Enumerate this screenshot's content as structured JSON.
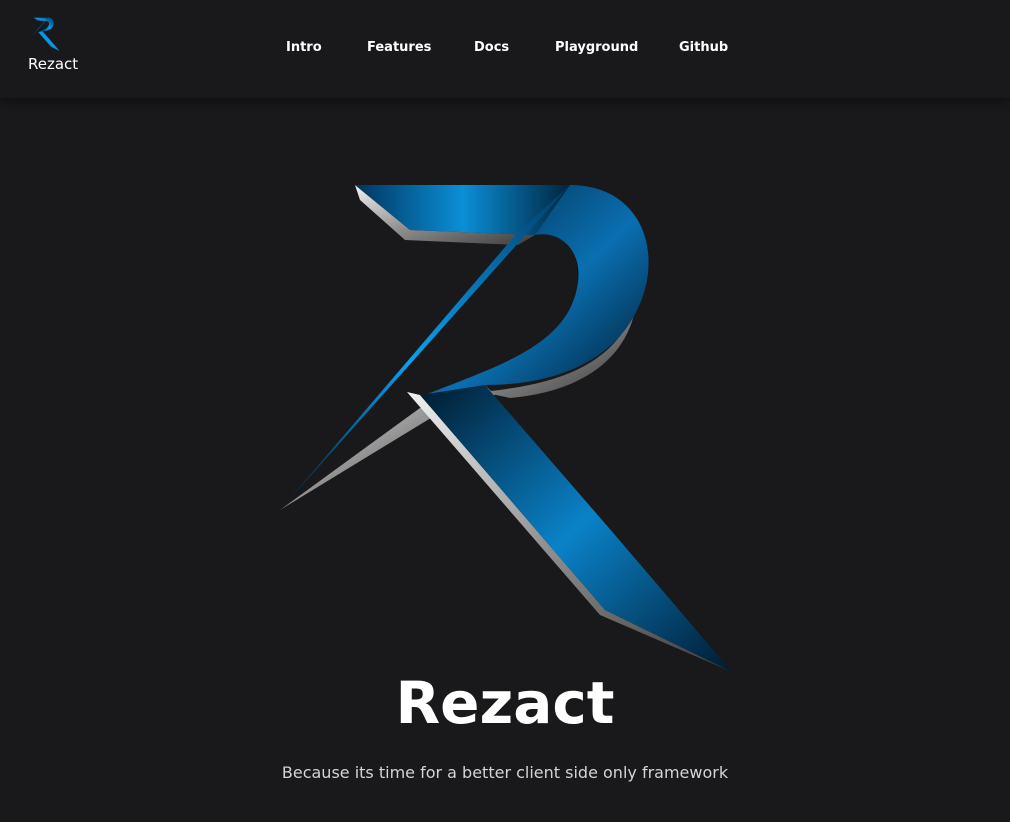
{
  "brand": {
    "name": "Rezact",
    "logo_icon": "rezact-r-logo-icon"
  },
  "nav": {
    "items": [
      {
        "label": "Intro"
      },
      {
        "label": "Features"
      },
      {
        "label": "Docs"
      },
      {
        "label": "Playground"
      },
      {
        "label": "Github"
      }
    ]
  },
  "hero": {
    "logo_icon": "rezact-r-logo-icon",
    "title": "Rezact",
    "tagline": "Because its time for a better client side only framework"
  },
  "colors": {
    "background": "#19191b",
    "accent_blue": "#0a9be8",
    "deep_blue": "#012a4a",
    "text": "#ffffff",
    "muted_text": "#d4d4d8"
  }
}
